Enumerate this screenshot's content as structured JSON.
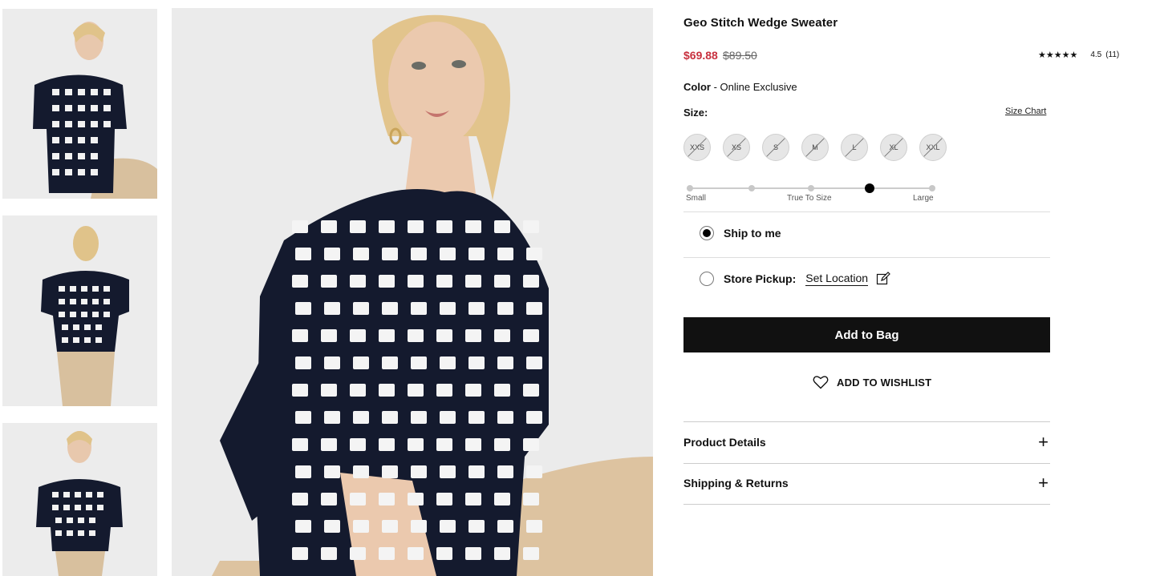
{
  "gallery": {
    "thumbnails": [
      {
        "alt": "front view thumbnail"
      },
      {
        "alt": "back view thumbnail"
      },
      {
        "alt": "full front view thumbnail"
      }
    ]
  },
  "product": {
    "title": "Geo Stitch Wedge Sweater",
    "sale_price": "$69.88",
    "original_price": "$89.50",
    "rating": {
      "stars": "★★★★★",
      "value": "4.5",
      "count": "(11)"
    },
    "color_label": "Color",
    "color_sep": " - ",
    "color_value": "Online Exclusive",
    "size_label": "Size:",
    "size_chart": "Size Chart",
    "sizes": [
      "XXS",
      "XS",
      "S",
      "M",
      "L",
      "XL",
      "XXL"
    ],
    "fit": {
      "small": "Small",
      "true_to_size": "True To Size",
      "large": "Large",
      "selected_index": 3
    }
  },
  "delivery": {
    "ship_label": "Ship to me",
    "pickup_label": "Store Pickup:",
    "set_location": "Set Location"
  },
  "actions": {
    "add_to_bag": "Add to Bag",
    "wishlist": "ADD TO WISHLIST"
  },
  "accordion": {
    "product_details": "Product Details",
    "shipping_returns": "Shipping & Returns",
    "expand_symbol": "+"
  },
  "colors": {
    "sale": "#c8313f",
    "button": "#111111",
    "sweater_navy": "#141a2e"
  }
}
